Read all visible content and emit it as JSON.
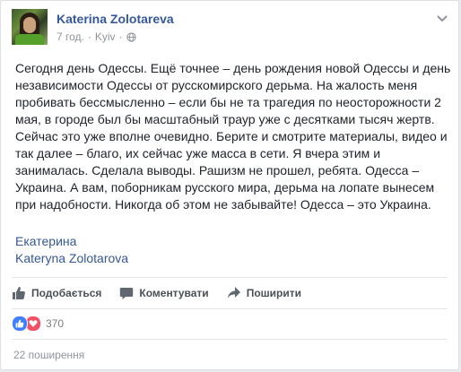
{
  "post": {
    "author_name": "Katerina Zolotareva",
    "time": "7 год.",
    "separator": "·",
    "location": "Kyiv",
    "audience_icon": "globe-icon",
    "menu_icon": "chevron-down-icon",
    "text": "Сегодня день Одессы. Ещё точнее – день рождения новой Одессы и день независимости Одессы от русскомирского дерьма. На жалость меня пробивать бессмысленно – если бы не та трагедия по неосторожности 2 мая, в городе был бы масштабный траур уже с десятками тысяч жертв. Сейчас это уже вполне очевидно. Берите и смотрите материалы, видео и так далее – благо, их сейчас уже масса в сети. Я вчера этим и занималась. Сделала выводы. Рашизм не прошел, ребята. Одесса – Украина. А вам, поборникам русского мира, дерьма на лопате вынесем при надобности. Никогда об этом не забывайте! Одесса – это Украина.",
    "signature_line1": "Екатерина",
    "signature_line2": "Kateryna Zolotarova"
  },
  "actions": {
    "like_label": "Подобається",
    "comment_label": "Коментувати",
    "share_label": "Поширити"
  },
  "reactions": {
    "types": [
      "like",
      "love"
    ],
    "count": "370"
  },
  "shares": {
    "label": "22 поширення"
  },
  "colors": {
    "link": "#365899",
    "muted": "#90949c",
    "text": "#1d2129",
    "like_blue": "#4080ff",
    "love_red": "#f25268"
  }
}
